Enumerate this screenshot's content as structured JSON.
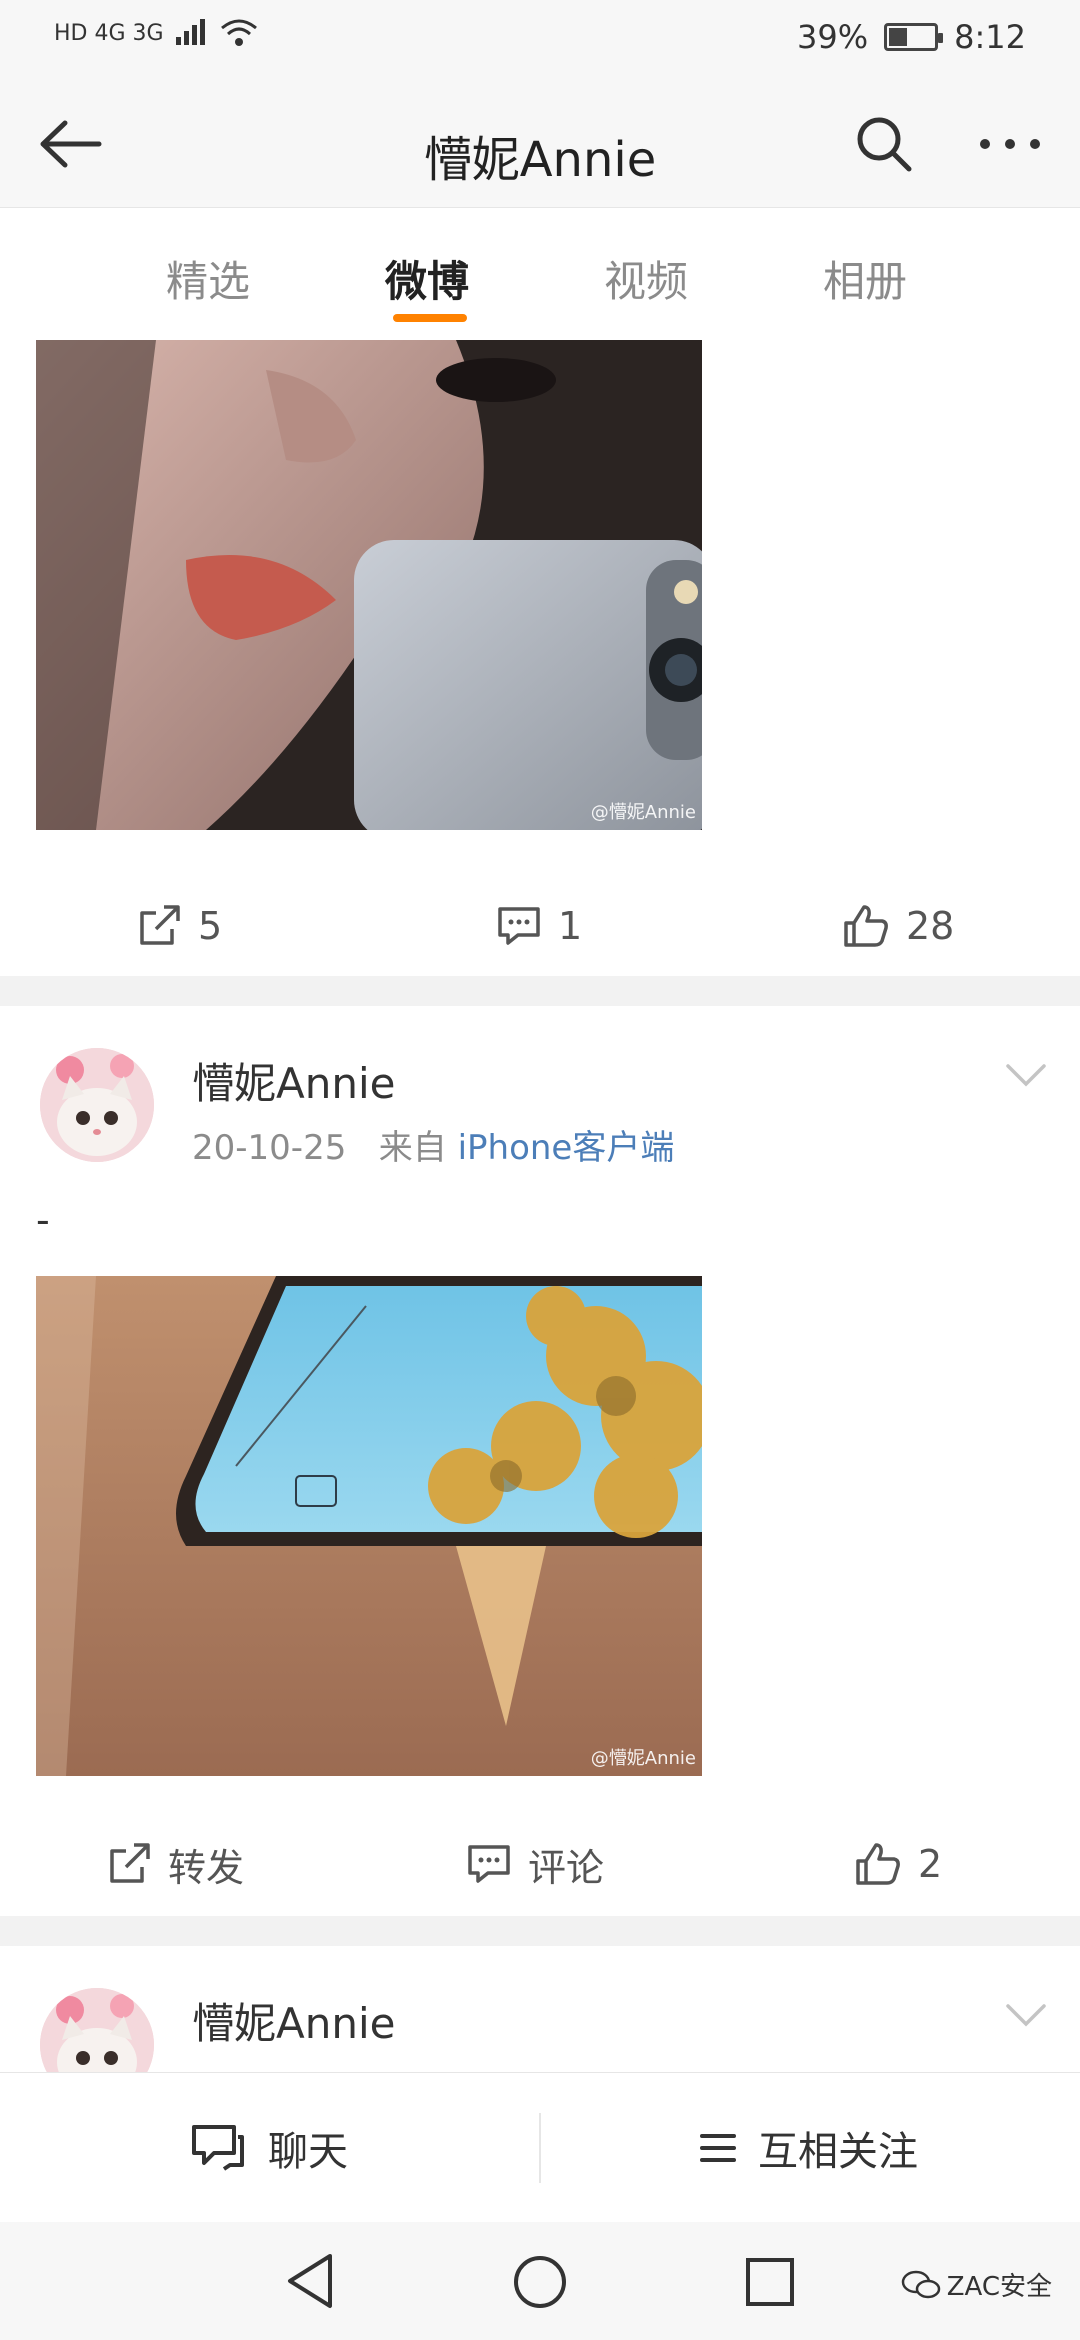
{
  "status_bar": {
    "network_left": "HD 4G 3G",
    "battery": "39%",
    "time": "8:12"
  },
  "header": {
    "title": "懵妮Annie",
    "back_icon": "back-arrow-icon",
    "search_icon": "search-icon",
    "more_icon": "more-icon"
  },
  "tabs": [
    {
      "label": "精选"
    },
    {
      "label": "微博"
    },
    {
      "label": "视频"
    },
    {
      "label": "相册"
    }
  ],
  "post1": {
    "watermark": "@懵妮Annie",
    "repost_count": "5",
    "comment_count": "1",
    "like_count": "28"
  },
  "post2": {
    "author": "懵妮Annie",
    "date": "20-10-25",
    "source_prefix": "来自",
    "source": "iPhone客户端",
    "text": "-",
    "watermark": "@懵妮Annie",
    "repost_label": "转发",
    "comment_label": "评论",
    "like_count": "2"
  },
  "post3": {
    "author": "懵妮Annie"
  },
  "bottom_bar": {
    "chat_label": "聊天",
    "follow_label": "互相关注"
  },
  "footer_watermark": "ZAC安全",
  "colors": {
    "accent": "#ff8200",
    "link": "#4c7eb8",
    "muted": "#8b8b8b"
  }
}
